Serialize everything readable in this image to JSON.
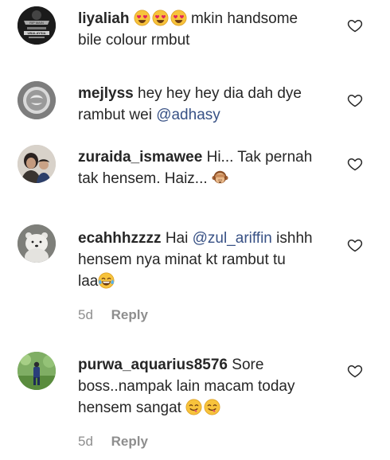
{
  "comments": [
    {
      "username": "liyaliah",
      "line1": "mkin handsome",
      "line2": "bile colour rmbut",
      "avatar_text": [
        "RIP MAIN",
        "UBALAYSIA"
      ]
    },
    {
      "username": "mejlyss",
      "line1": "hey hey hey dia dah dye",
      "line2_text": "rambut wei ",
      "mention": "@adhasy"
    },
    {
      "username": "zuraida_ismawee",
      "line1": "Hi... Tak pernah",
      "line2": "tak hensem. Haiz..."
    },
    {
      "username": "ecahhhzzzz",
      "line1_pre": "Hai ",
      "mention": "@zul_ariffin",
      "line1_post": " ishhh",
      "line2": "hensem nya minat kt rambut tu",
      "line3": "laa",
      "time": "5d",
      "reply": "Reply"
    },
    {
      "username": "purwa_aquarius8576",
      "line1": "Sore",
      "line2": "boss..nampak lain macam today",
      "line3": "hensem sangat",
      "time": "5d",
      "reply": "Reply"
    }
  ],
  "colors": {
    "text": "#262626",
    "mention": "#385185",
    "muted": "#8e8e8e"
  }
}
